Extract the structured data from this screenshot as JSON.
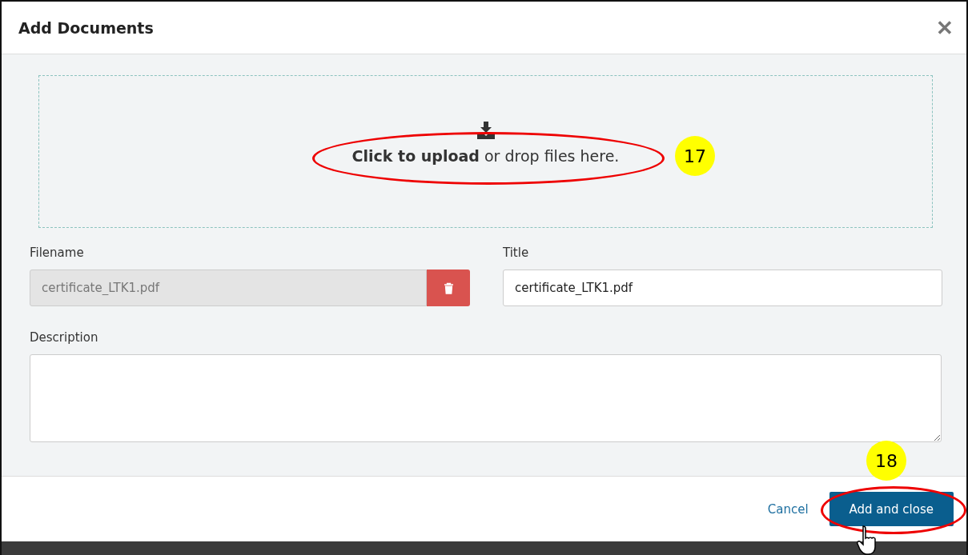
{
  "dialog": {
    "title": "Add Documents",
    "close": "✕"
  },
  "upload": {
    "action": "Click to upload",
    "rest": " or drop files here."
  },
  "fields": [
    {
      "kind": "file",
      "label": "Filename",
      "value": "certificate_LTK1.pdf",
      "disabled": true
    },
    {
      "kind": "text",
      "label": "Title",
      "value": "certificate_LTK1.pdf",
      "disabled": false
    }
  ],
  "description": {
    "label": "Description"
  },
  "footer": {
    "cancel": "Cancel",
    "submit": "Add and close"
  },
  "annotations": [
    {
      "label": "17"
    },
    {
      "label": "18"
    }
  ]
}
